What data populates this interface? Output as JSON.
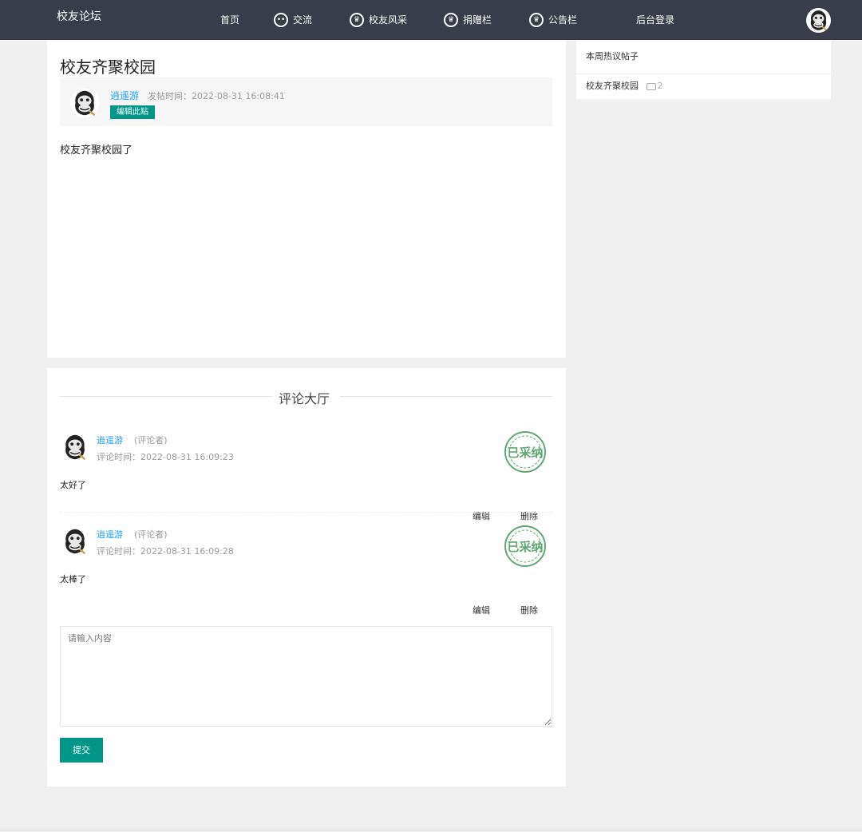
{
  "header": {
    "logo": "校友论坛",
    "nav": [
      {
        "label": "首页",
        "icon": "none"
      },
      {
        "label": "交流",
        "icon": "chat-icon"
      },
      {
        "label": "校友风采",
        "icon": "crown-icon"
      },
      {
        "label": "捐赠栏",
        "icon": "crown-icon"
      },
      {
        "label": "公告栏",
        "icon": "crown-icon"
      },
      {
        "label": "后台登录",
        "icon": "none"
      }
    ]
  },
  "post": {
    "title": "校友齐聚校园",
    "author": "逍遥游",
    "time": "发帖时间：2022-08-31 16:08:41",
    "edit_label": "编辑此贴",
    "body": "校友齐聚校园了"
  },
  "sidebar": {
    "heading": "本周热议帖子",
    "items": [
      {
        "title": "校友齐聚校园",
        "comments": "2"
      }
    ]
  },
  "comments_section": {
    "title": "评论大厅",
    "comments": [
      {
        "name": "逍遥游",
        "role": "(评论者)",
        "time": "评论时间：2022-08-31 16:09:23",
        "text": "太好了",
        "stamp": "已采纳",
        "edit": "编辑",
        "delete": "删除"
      },
      {
        "name": "逍遥游",
        "role": "(评论者)",
        "time": "评论时间：2022-08-31 16:09:28",
        "text": "太棒了",
        "stamp": "已采纳",
        "edit": "编辑",
        "delete": "删除"
      }
    ],
    "input_placeholder": "请输入内容",
    "submit_label": "提交"
  },
  "colors": {
    "header_bg": "#393d49",
    "accent": "#009688",
    "link": "#1e9fff",
    "stamp": "#5fa870"
  }
}
